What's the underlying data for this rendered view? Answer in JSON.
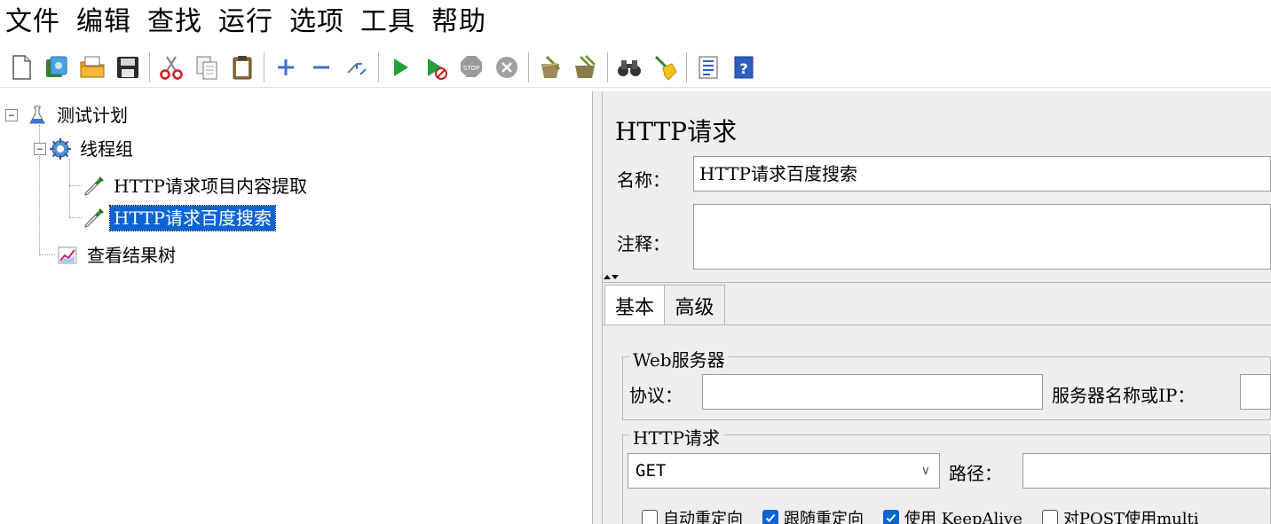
{
  "menu": {
    "items": [
      "文件",
      "编辑",
      "查找",
      "运行",
      "选项",
      "工具",
      "帮助"
    ]
  },
  "toolbar": {
    "buttons": [
      {
        "icon": "new-file-icon"
      },
      {
        "icon": "templates-icon"
      },
      {
        "icon": "open-folder-icon"
      },
      {
        "icon": "save-icon"
      },
      {
        "icon": "cut-icon"
      },
      {
        "icon": "copy-icon"
      },
      {
        "icon": "paste-icon"
      },
      {
        "icon": "expand-plus-icon"
      },
      {
        "icon": "collapse-minus-icon"
      },
      {
        "icon": "toggle-icon"
      },
      {
        "icon": "start-icon"
      },
      {
        "icon": "start-no-pause-icon"
      },
      {
        "icon": "stop-icon"
      },
      {
        "icon": "shutdown-icon"
      },
      {
        "icon": "clear-icon"
      },
      {
        "icon": "clear-all-icon"
      },
      {
        "icon": "search-binoculars-icon"
      },
      {
        "icon": "reset-search-broom-icon"
      },
      {
        "icon": "function-helper-icon"
      },
      {
        "icon": "help-icon"
      }
    ]
  },
  "tree": {
    "nodes": [
      {
        "label": "测试计划",
        "icon": "flask-icon",
        "expanded": true,
        "level": 0
      },
      {
        "label": "线程组",
        "icon": "gear-icon",
        "expanded": true,
        "level": 1
      },
      {
        "label": "HTTP请求项目内容提取",
        "icon": "pipette-icon",
        "level": 2
      },
      {
        "label": "HTTP请求百度搜索",
        "icon": "pipette-icon",
        "level": 2,
        "selected": true
      },
      {
        "label": "查看结果树",
        "icon": "graph-icon",
        "level": 1
      }
    ]
  },
  "panel": {
    "title": "HTTP请求",
    "name_label": "名称：",
    "name_value": "HTTP请求百度搜索",
    "comment_label": "注释：",
    "comment_value": "",
    "tabs": [
      {
        "label": "基本",
        "active": true
      },
      {
        "label": "高级",
        "active": false
      }
    ],
    "web_server": {
      "title": "Web服务器",
      "protocol_label": "协议：",
      "protocol_value": "",
      "server_label": "服务器名称或IP：",
      "server_value": ""
    },
    "http_request": {
      "title": "HTTP请求",
      "method": "GET",
      "path_label": "路径：",
      "path_value": "",
      "options": [
        {
          "label": "自动重定向",
          "checked": false
        },
        {
          "label": "跟随重定向",
          "checked": true
        },
        {
          "label": "使用 KeepAlive",
          "checked": true
        },
        {
          "label": "对POST使用multi",
          "checked": false
        }
      ]
    }
  },
  "colors": {
    "selection": "#0a64d4",
    "panel_bg": "#eeeeee",
    "checkbox_checked": "#0a64d4"
  }
}
